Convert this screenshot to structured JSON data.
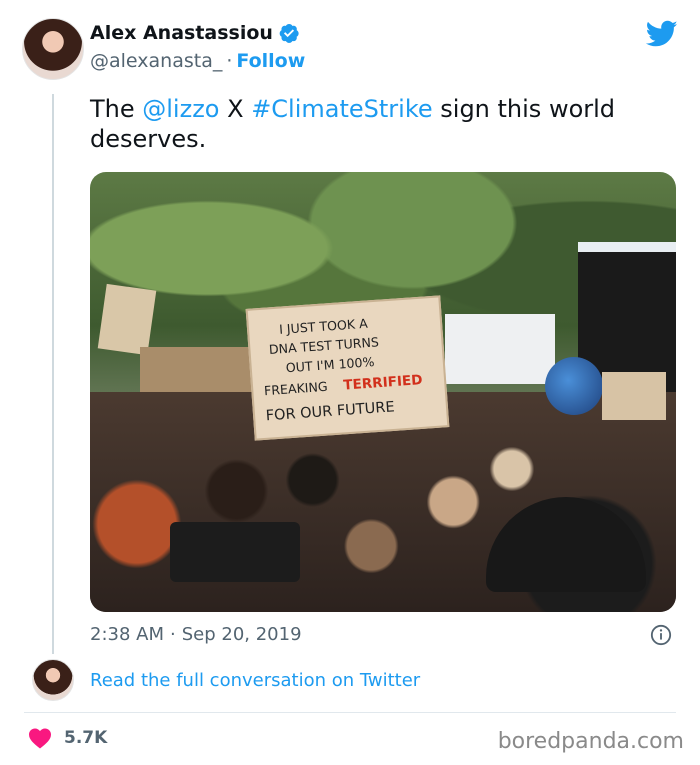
{
  "author": {
    "name": "Alex Anastassiou",
    "handle": "@alexanasta_",
    "separator": "·",
    "follow_label": "Follow"
  },
  "tweet": {
    "text_prefix": "The ",
    "mention": "@lizzo",
    "text_mid": " X ",
    "hashtag": "#ClimateStrike",
    "text_suffix": " sign this world deserves."
  },
  "photo": {
    "sign_text": [
      "I JUST TOOK A",
      "DNA TEST TURNS",
      "OUT I'M 100%",
      "FREAKING",
      "TERRIFIED",
      "FOR OUR FUTURE"
    ]
  },
  "meta": {
    "time": "2:38 AM",
    "separator": "·",
    "date": "Sep 20, 2019"
  },
  "read_more": "Read the full conversation on Twitter",
  "likes": {
    "count": "5.7K"
  },
  "watermark": "boredpanda.com",
  "colors": {
    "twitter_blue": "#1d9bf0",
    "like_red": "#f91880",
    "muted": "#536471"
  },
  "icons": {
    "verified": "verified-badge-icon",
    "bird": "twitter-bird-icon",
    "info": "info-icon",
    "heart": "heart-icon"
  }
}
